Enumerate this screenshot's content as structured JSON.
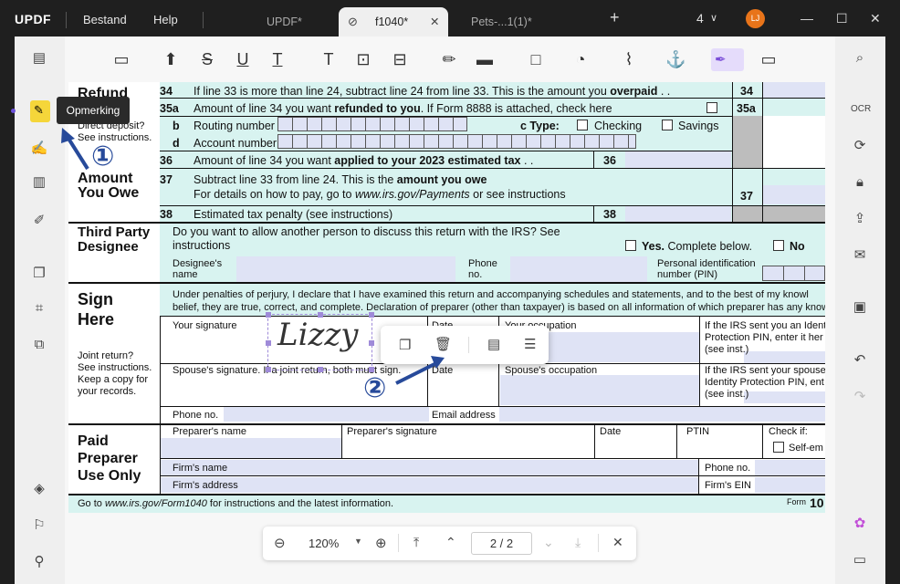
{
  "app": {
    "logo": "UPDF",
    "menu": [
      "Bestand",
      "Help"
    ],
    "tabs": [
      "UPDF*",
      "f1040*",
      "Pets-...1(1)*"
    ],
    "tab_count": "4",
    "avatar_initials": "LJ",
    "new_tab": "+"
  },
  "tooltip": "Opmerking",
  "form": {
    "refund_header": "Refund",
    "direct_deposit": "Direct deposit?",
    "see_instr": "See instructions.",
    "line34_num": "34",
    "line34_text_a": "If line 33 is more than line 24, subtract line 24 from line 33. This is the amount you ",
    "line34_text_b": "overpaid",
    "line34_box": "34",
    "line35a_num": "35a",
    "line35a_text_a": "Amount of line 34 you want ",
    "line35a_text_b": "refunded to you",
    ". If Form 8888 is attached, check here": "",
    "line35a_text_c": ". If Form 8888 is attached, check here",
    "line35a_box": "35a",
    "b": "b",
    "routing": "Routing number",
    "ctype": "c Type:",
    "checking": "Checking",
    "savings": "Savings",
    "d": "d",
    "account": "Account number",
    "line36_num": "36",
    "line36_text_a": "Amount of line 34 you want ",
    "line36_text_b": "applied to your 2023 estimated tax",
    "line36_box": "36",
    "amount_owe_1": "Amount",
    "amount_owe_2": "You Owe",
    "line37_num": "37",
    "line37_text_a": "Subtract line 33 from line 24. This is the ",
    "line37_text_b": "amount you owe",
    "line37_text_c": "For details on how to pay, go to ",
    "line37_text_d": "www.irs.gov/Payments",
    "line37_text_e": " or see instructions",
    "line37_box": "37",
    "line38_num": "38",
    "line38_text": "Estimated tax penalty (see instructions)",
    "line38_box": "38",
    "third_1": "Third Party",
    "third_2": "Designee",
    "third_q": "Do you want to allow another person to discuss this return with the IRS? See",
    "third_q2": "instructions",
    "yes": "Yes.",
    "yes_rest": " Complete below.",
    "no": "No",
    "designee_name_1": "Designee's",
    "designee_name_2": "name",
    "phone_1": "Phone",
    "phone_2": "no.",
    "pin_1": "Personal identification",
    "pin_2": "number (PIN)",
    "sign_1": "Sign",
    "sign_2": "Here",
    "perjury_1": "Under penalties of perjury, I declare that I have examined this return and accompanying schedules and statements, and to the best of my knowl",
    "perjury_2": "belief, they are true, correct, and complete. Declaration of preparer (other than taxpayer) is based on all information of which preparer has any know",
    "your_sig": "Your signature",
    "date": "Date",
    "your_occ": "Your occupation",
    "irs_pin_1": "If the IRS sent you an Identi",
    "irs_pin_2": "Protection PIN, enter it her",
    "irs_pin_3": "(see inst.)",
    "joint_1": "Joint return?",
    "joint_2": "See instructions.",
    "joint_3": "Keep a copy for",
    "joint_4": "your records.",
    "spouse_sig": "Spouse's signature. If a joint return, both must sign.",
    "spouse_date": "Date",
    "spouse_occ": "Spouse's occupation",
    "spouse_pin_1": "If the IRS sent your spouse",
    "spouse_pin_2": "Identity Protection PIN, ent",
    "spouse_pin_3": "(see inst.)",
    "phone_no": "Phone no.",
    "email": "Email address",
    "paid_1": "Paid",
    "paid_2": "Preparer",
    "paid_3": "Use Only",
    "prep_name": "Preparer's name",
    "prep_sig": "Preparer's signature",
    "prep_date": "Date",
    "ptin": "PTIN",
    "check_if": "Check if:",
    "self_emp": "Self-em",
    "firm_name": "Firm's name",
    "firm_phone": "Phone no.",
    "firm_addr": "Firm's address",
    "firm_ein": "Firm's EIN",
    "footer_a": "Go to ",
    "footer_b": "www.irs.gov/Form1040",
    "footer_c": " for instructions and the latest information.",
    "footer_form": "Form",
    "footer_num": "10",
    "signature": "Lizzy"
  },
  "bottombar": {
    "zoom": "120%",
    "page": "2 / 2"
  },
  "annotations": {
    "one": "①",
    "two": "②"
  }
}
